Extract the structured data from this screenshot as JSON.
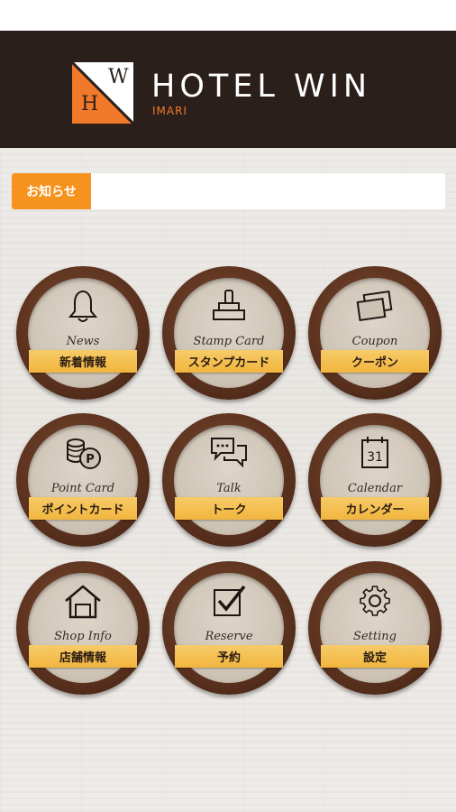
{
  "header": {
    "logo_letter_1": "W",
    "logo_letter_2": "H",
    "hotel_name": "HOTEL WIN",
    "hotel_sub": "IMARI"
  },
  "news": {
    "label": "お知らせ",
    "text": ""
  },
  "menu": [
    {
      "script": "News",
      "label": "新着情報",
      "icon": "bell-icon"
    },
    {
      "script": "Stamp Card",
      "label": "スタンプカード",
      "icon": "stamp-icon"
    },
    {
      "script": "Coupon",
      "label": "クーポン",
      "icon": "coupon-icon"
    },
    {
      "script": "Point Card",
      "label": "ポイントカード",
      "icon": "coins-icon"
    },
    {
      "script": "Talk",
      "label": "トーク",
      "icon": "chat-icon"
    },
    {
      "script": "Calendar",
      "label": "カレンダー",
      "icon": "calendar-icon",
      "calendar_day": "31"
    },
    {
      "script": "Shop Info",
      "label": "店舗情報",
      "icon": "house-icon"
    },
    {
      "script": "Reserve",
      "label": "予約",
      "icon": "checkbox-icon"
    },
    {
      "script": "Setting",
      "label": "設定",
      "icon": "gear-icon"
    }
  ],
  "colors": {
    "header_bg": "#2b1f1c",
    "accent_orange": "#f07a2a",
    "news_label_bg": "#f6921e",
    "ribbon": "#f2b53e",
    "ring_brown": "#5a311e"
  }
}
